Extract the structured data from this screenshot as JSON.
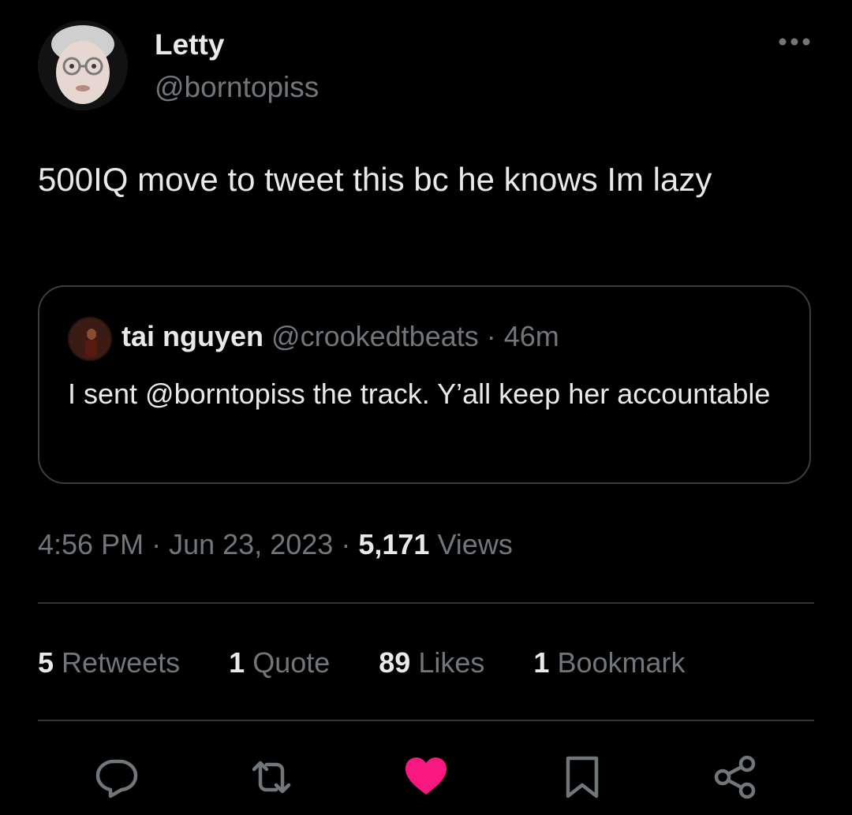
{
  "author": {
    "display_name": "Letty",
    "handle": "@borntopiss"
  },
  "tweet": {
    "text": "500IQ move to tweet this bc he knows Im lazy"
  },
  "quoted_tweet": {
    "display_name": "tai nguyen",
    "handle": "@crookedtbeats",
    "separator": "·",
    "age": "46m",
    "text": "I sent @borntopiss the track. Y’all keep her accountable"
  },
  "meta": {
    "time": "4:56 PM",
    "sep1": "·",
    "date": "Jun 23, 2023",
    "sep2": "·",
    "views_count": "5,171",
    "views_label": "Views"
  },
  "stats": {
    "retweets_count": "5",
    "retweets_label": "Retweets",
    "quotes_count": "1",
    "quotes_label": "Quote",
    "likes_count": "89",
    "likes_label": "Likes",
    "bookmarks_count": "1",
    "bookmarks_label": "Bookmark"
  },
  "actions": {
    "reply_icon": "reply-icon",
    "retweet_icon": "retweet-icon",
    "like_icon": "heart-icon",
    "bookmark_icon": "bookmark-icon",
    "share_icon": "share-icon"
  },
  "colors": {
    "background": "#000000",
    "text_primary": "#e7e9ea",
    "text_secondary": "#71767b",
    "border": "#2f3336",
    "like_active": "#f91880"
  }
}
